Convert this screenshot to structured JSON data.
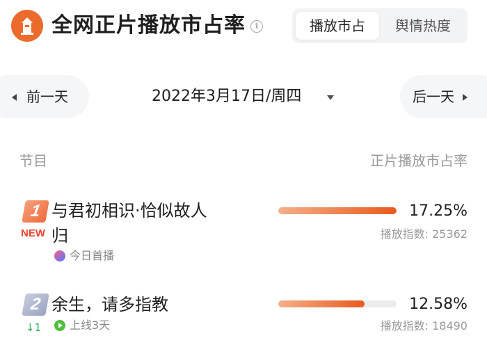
{
  "header": {
    "title": "全网正片播放市占率",
    "tabs": [
      {
        "label": "播放市占",
        "active": true
      },
      {
        "label": "舆情热度",
        "active": false
      }
    ]
  },
  "date_nav": {
    "prev_label": "前一天",
    "date": "2022年3月17日/周四",
    "next_label": "后一天"
  },
  "table": {
    "col_program": "节目",
    "col_share": "正片播放市占率",
    "rows": [
      {
        "rank": "1",
        "badge": "NEW",
        "name": "与君初相识·恰似故人归",
        "platform_icon": "youku-icon",
        "sub": "今日首播",
        "share": "17.25%",
        "share_value": 17.25,
        "bar_fraction": 1.0,
        "index_text": "播放指数: 25362"
      },
      {
        "rank": "2",
        "rank_change": "↓1",
        "name": "余生，请多指教",
        "platform_icon": "iqiyi-icon",
        "sub": "上线3天",
        "share": "12.58%",
        "share_value": 12.58,
        "bar_fraction": 0.73,
        "index_text": "播放指数: 18490"
      }
    ]
  },
  "colors": {
    "accent": "#ec6a2b",
    "new_tag": "#e8432b",
    "rank_down": "#2fae5a"
  }
}
